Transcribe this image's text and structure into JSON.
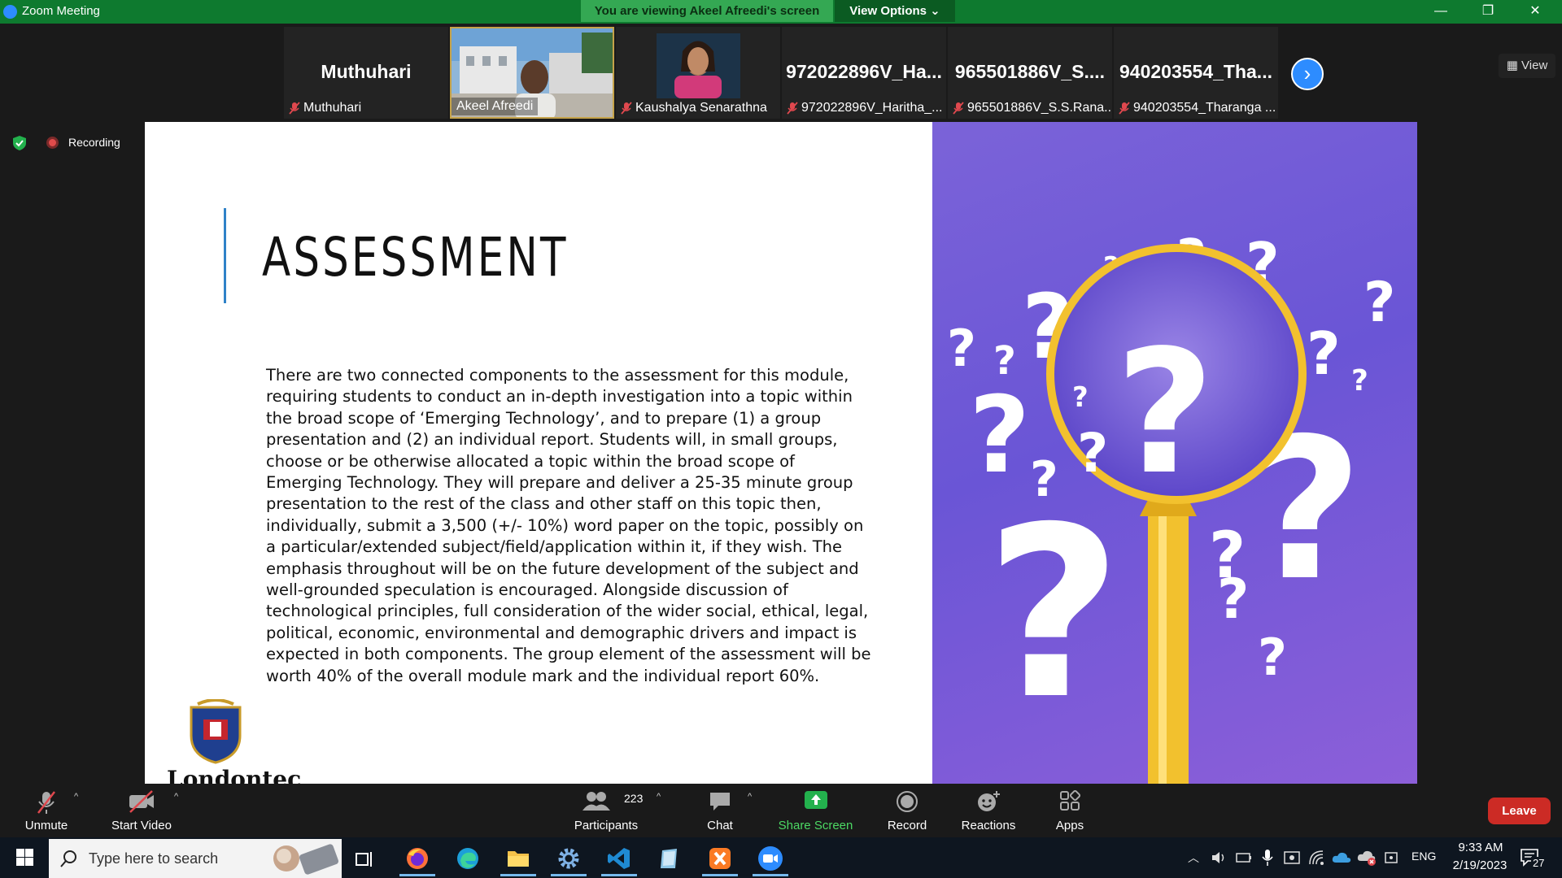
{
  "window": {
    "title": "Zoom Meeting"
  },
  "banner": {
    "viewing": "You are viewing Akeel Afreedi's screen",
    "view_options": "View Options ⌄"
  },
  "window_controls": {
    "minimize": "—",
    "restore": "❐",
    "close": "✕"
  },
  "participants": [
    {
      "big_label": "Muthuhari",
      "name": "Muthuhari",
      "muted": true,
      "video": false
    },
    {
      "big_label": "",
      "name": "Akeel Afreedi",
      "muted": false,
      "video": true
    },
    {
      "big_label": "",
      "name": "Kaushalya Senarathna",
      "muted": true,
      "video": true
    },
    {
      "big_label": "972022896V_Ha...",
      "name": "972022896V_Haritha_...",
      "muted": true,
      "video": false
    },
    {
      "big_label": "965501886V_S....",
      "name": "965501886V_S.S.Rana...",
      "muted": true,
      "video": false
    },
    {
      "big_label": "940203554_Tha...",
      "name": "940203554_Tharanga ...",
      "muted": true,
      "video": false
    }
  ],
  "view_button": "View",
  "recording": {
    "label": "Recording"
  },
  "slide": {
    "title": "ASSESSMENT",
    "body": "There are two connected components to the assessment for this module, requiring students to conduct an in-depth investigation into a topic within the broad scope of ‘Emerging Technology’, and to prepare (1) a group presentation and (2) an individual report. Students will, in small groups, choose or be otherwise allocated a topic within the broad scope of Emerging Technology. They will prepare and deliver a 25-35 minute group presentation to the rest of the class and other staff on this topic then, individually, submit a 3,500 (+/- 10%) word paper on the topic, possibly on a particular/extended subject/field/application within it, if they wish. The emphasis throughout will be on the future development of the subject and well-grounded speculation is encouraged. Alongside discussion of technological principles, full consideration of the wider social, ethical, legal, political, economic, environmental and demographic drivers and impact is expected in both components. The group element of the assessment will be worth 40% of the overall module mark and the individual report 60%.",
    "org_text": "Londontec"
  },
  "toolbar": {
    "unmute": "Unmute",
    "start_video": "Start Video",
    "participants": "Participants",
    "participant_count": "223",
    "chat": "Chat",
    "share_screen": "Share Screen",
    "record": "Record",
    "reactions": "Reactions",
    "apps": "Apps",
    "leave": "Leave"
  },
  "taskbar": {
    "search_placeholder": "Type here to search",
    "lang": "ENG",
    "time": "9:33 AM",
    "date": "2/19/2023",
    "notifications": "27"
  },
  "colors": {
    "zoom_green": "#0e7a2f",
    "banner_green": "#34a853",
    "zoom_blue": "#2d8cff",
    "leave_red": "#cc2b25",
    "slide_purple": "#6a55d6",
    "magnifier_yellow": "#f2c12e"
  }
}
